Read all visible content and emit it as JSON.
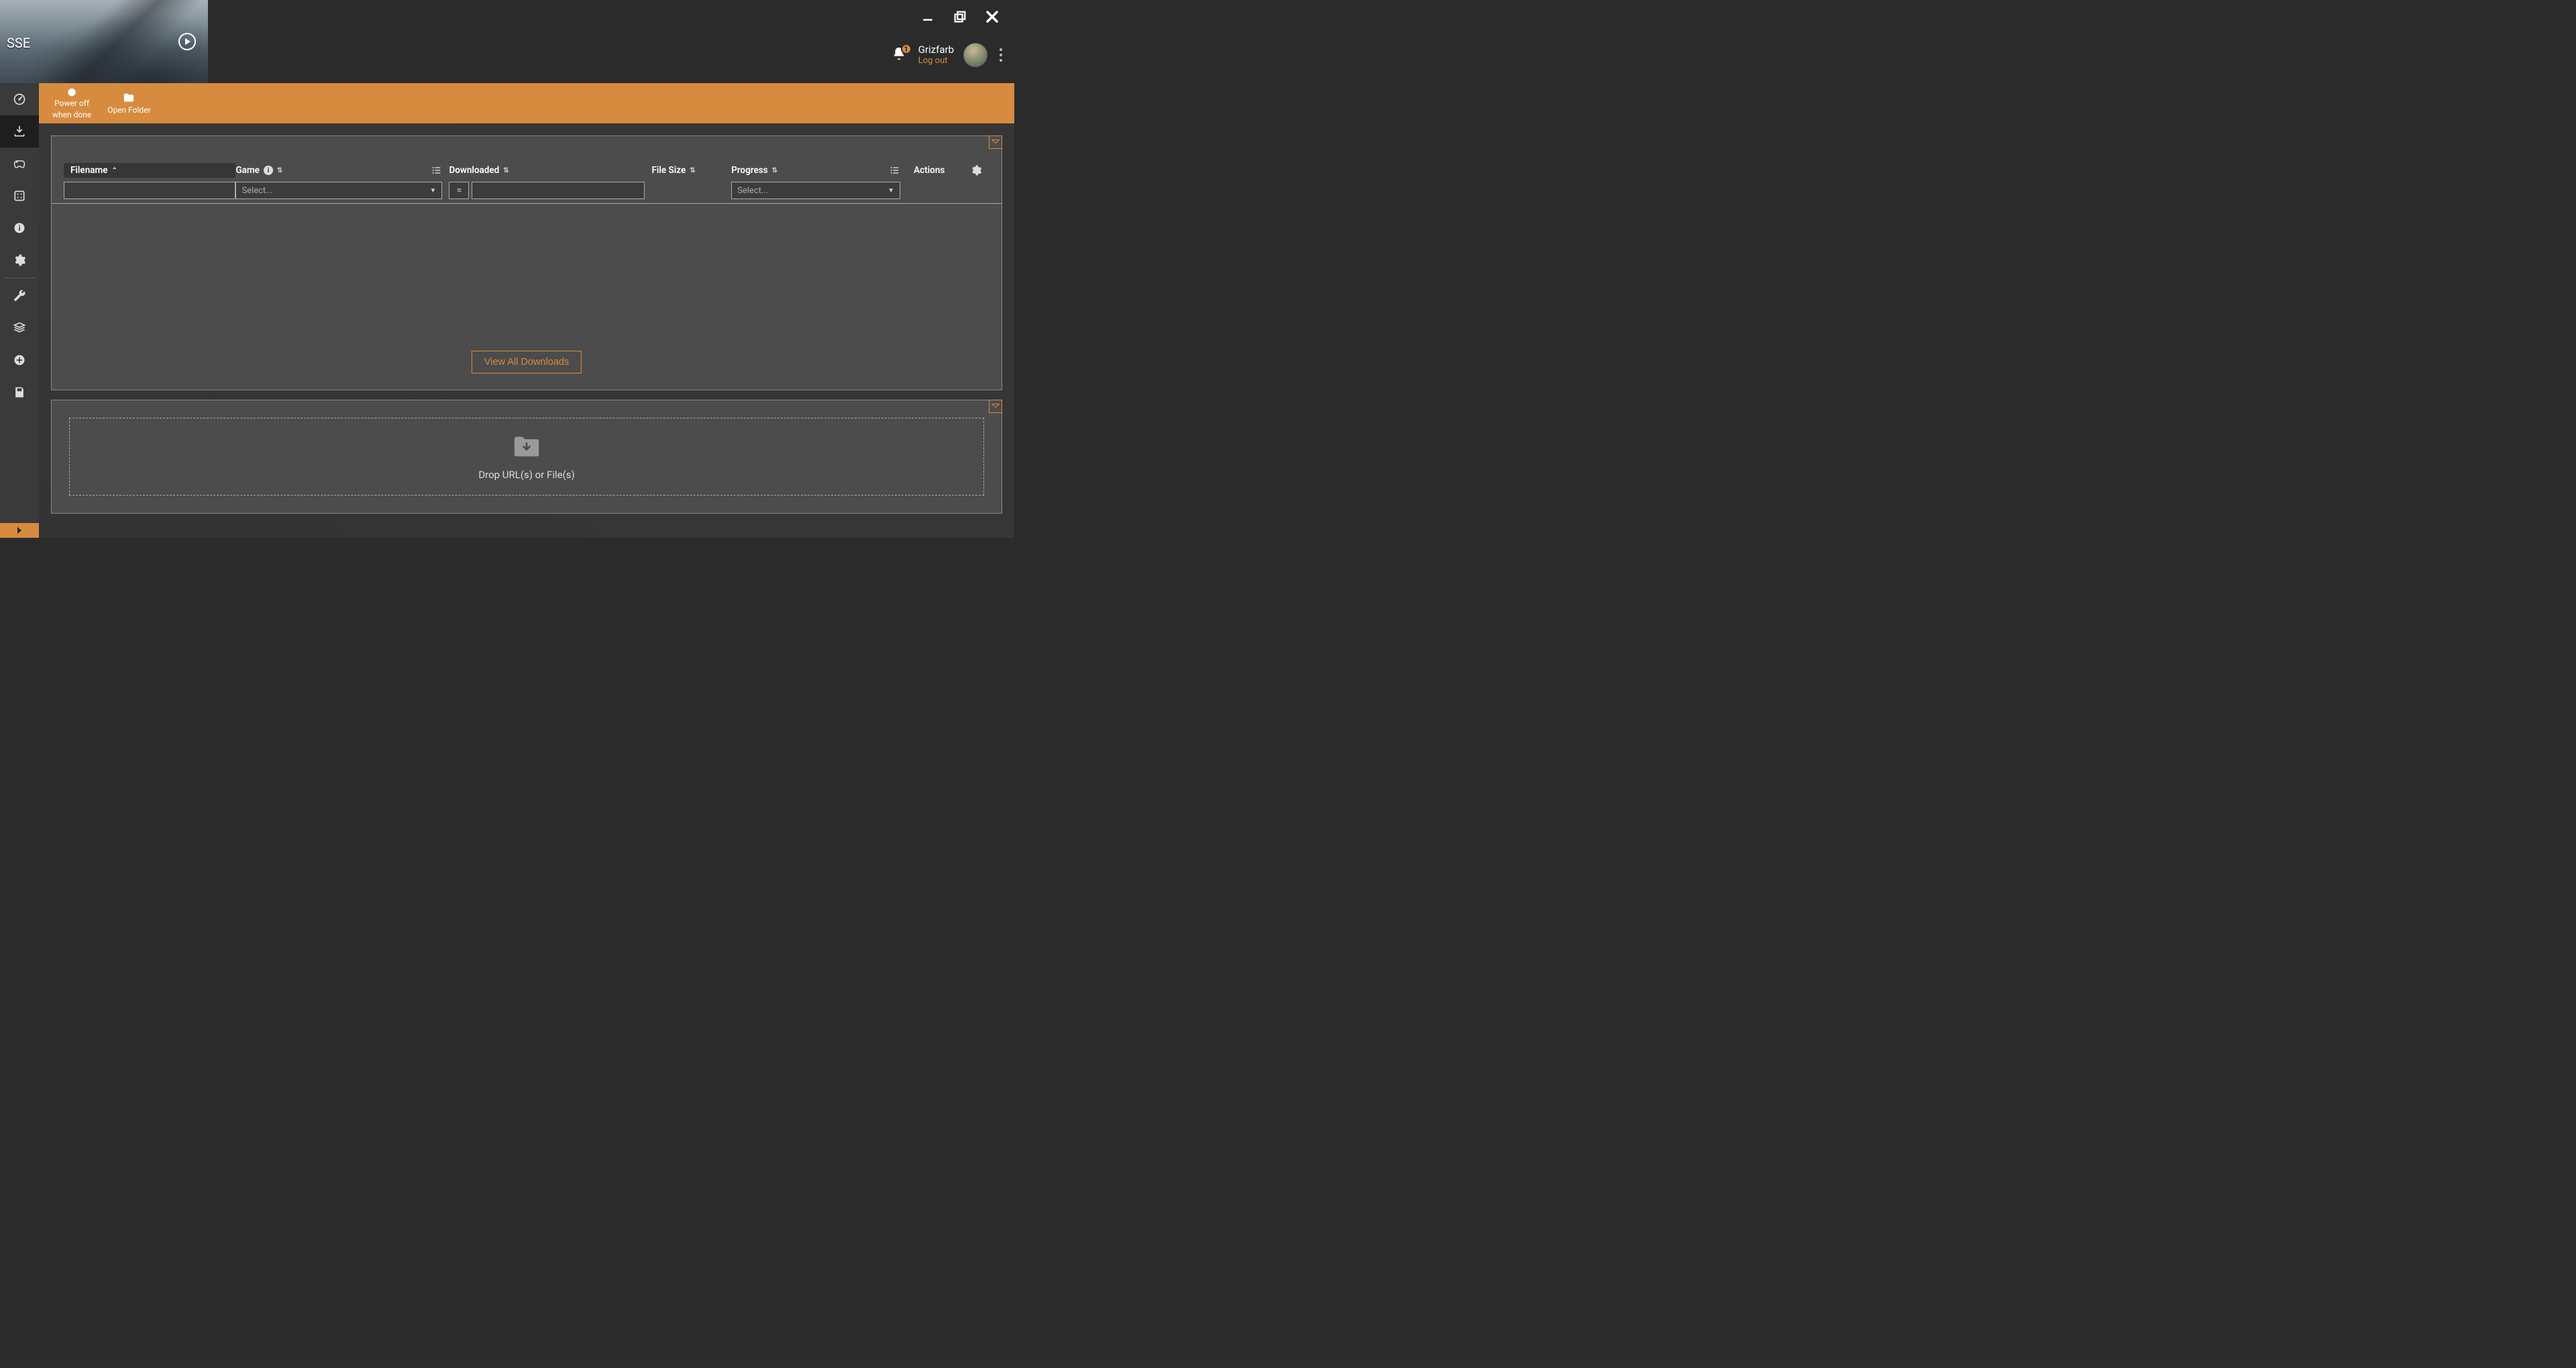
{
  "title": {
    "game_short": "SSE"
  },
  "user": {
    "name": "Grizfarb",
    "logout": "Log out",
    "notif_count": "1"
  },
  "toolbar": {
    "power_line1": "Power off",
    "power_line2": "when done",
    "open_folder": "Open Folder"
  },
  "columns": {
    "filename": "Filename",
    "game": "Game",
    "downloaded": "Downloaded",
    "filesize": "File Size",
    "progress": "Progress",
    "actions": "Actions",
    "select_placeholder": "Select...",
    "eq": "="
  },
  "buttons": {
    "view_all": "View All Downloads"
  },
  "dropzone": {
    "label": "Drop URL(s) or File(s)"
  }
}
